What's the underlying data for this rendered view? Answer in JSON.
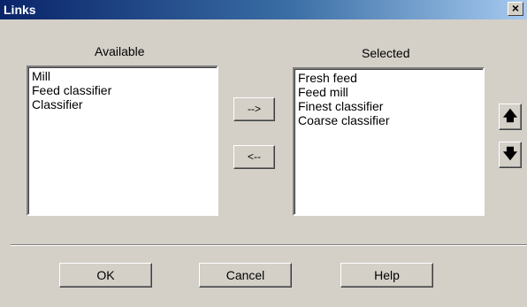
{
  "window": {
    "title": "Links",
    "close_glyph": "✕"
  },
  "available": {
    "label": "Available",
    "items": [
      "Mill",
      "Feed classifier",
      "Classifier"
    ]
  },
  "selected": {
    "label": "Selected",
    "items": [
      "Fresh feed",
      "Feed mill",
      "Finest classifier",
      "Coarse classifier"
    ]
  },
  "move_buttons": {
    "add": "-->",
    "remove": "<--"
  },
  "order_buttons": {
    "up_icon": "arrow-up",
    "down_icon": "arrow-down",
    "up_glyph": "🡅",
    "down_glyph": "🡇"
  },
  "footer": {
    "ok": "OK",
    "cancel": "Cancel",
    "help": "Help"
  }
}
